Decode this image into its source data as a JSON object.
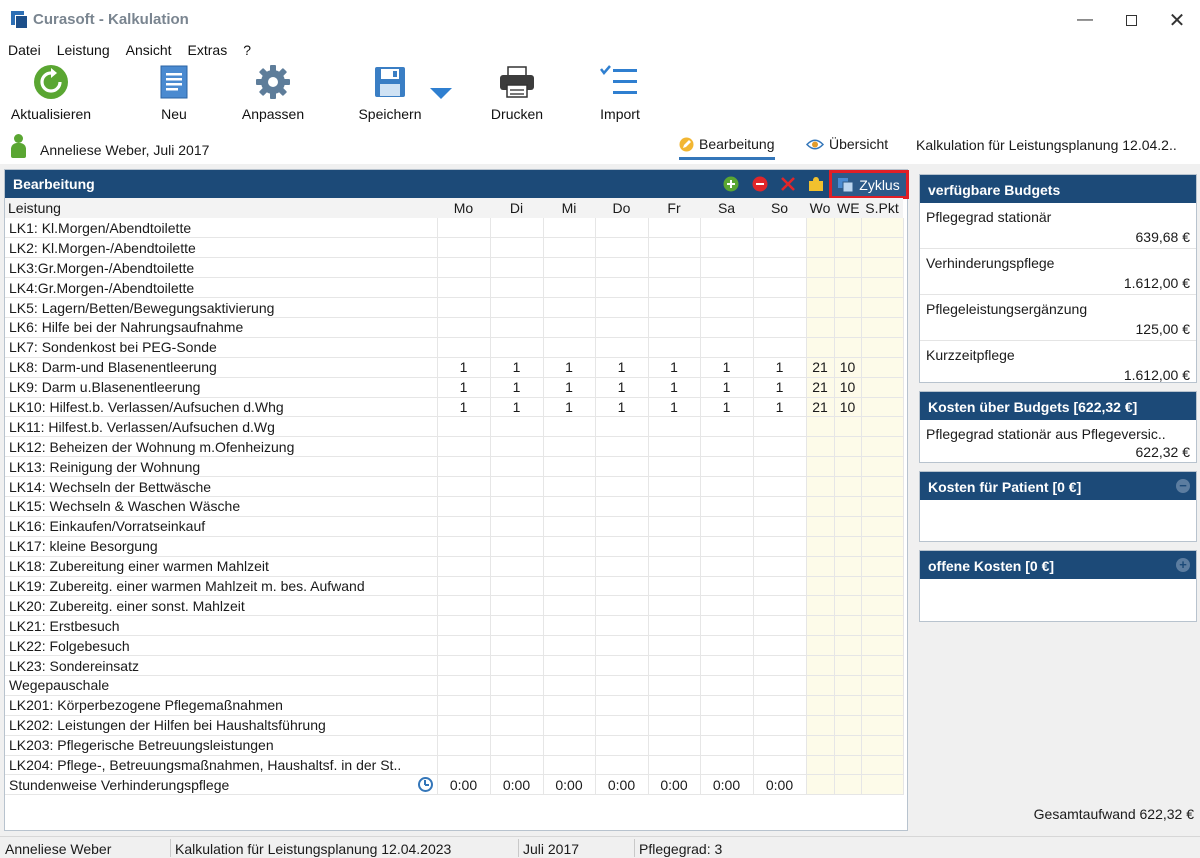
{
  "window": {
    "title": "Curasoft - Kalkulation"
  },
  "menu": [
    "Datei",
    "Leistung",
    "Ansicht",
    "Extras",
    "?"
  ],
  "toolbar": {
    "refresh": "Aktualisieren",
    "new": "Neu",
    "adjust": "Anpassen",
    "save": "Speichern",
    "print": "Drucken",
    "import": "Import"
  },
  "info": {
    "patient": "Anneliese Weber, Juli 2017",
    "tab_edit": "Bearbeitung",
    "tab_overview": "Übersicht",
    "calc_title": "Kalkulation für Leistungsplanung 12.04.2.."
  },
  "edit_panel": {
    "title": "Bearbeitung",
    "cycle_label": "Zyklus",
    "columns": [
      "Leistung",
      "Mo",
      "Di",
      "Mi",
      "Do",
      "Fr",
      "Sa",
      "So",
      "Wo",
      "WE",
      "S.Pkt"
    ],
    "rows": [
      [
        "LK1: Kl.Morgen/Abendtoilette",
        "",
        "",
        "",
        "",
        "",
        "",
        "",
        "",
        "",
        ""
      ],
      [
        "LK2: Kl.Morgen-/Abendtoilette",
        "",
        "",
        "",
        "",
        "",
        "",
        "",
        "",
        "",
        ""
      ],
      [
        "LK3:Gr.Morgen-/Abendtoilette",
        "",
        "",
        "",
        "",
        "",
        "",
        "",
        "",
        "",
        ""
      ],
      [
        "LK4:Gr.Morgen-/Abendtoilette",
        "",
        "",
        "",
        "",
        "",
        "",
        "",
        "",
        "",
        ""
      ],
      [
        "LK5: Lagern/Betten/Bewegungsaktivierung",
        "",
        "",
        "",
        "",
        "",
        "",
        "",
        "",
        "",
        ""
      ],
      [
        "LK6: Hilfe bei der Nahrungsaufnahme",
        "",
        "",
        "",
        "",
        "",
        "",
        "",
        "",
        "",
        ""
      ],
      [
        "LK7: Sondenkost bei PEG-Sonde",
        "",
        "",
        "",
        "",
        "",
        "",
        "",
        "",
        "",
        ""
      ],
      [
        "LK8: Darm-und Blasenentleerung",
        "1",
        "1",
        "1",
        "1",
        "1",
        "1",
        "1",
        "21",
        "10",
        ""
      ],
      [
        "LK9: Darm u.Blasenentleerung",
        "1",
        "1",
        "1",
        "1",
        "1",
        "1",
        "1",
        "21",
        "10",
        ""
      ],
      [
        "LK10: Hilfest.b. Verlassen/Aufsuchen d.Whg",
        "1",
        "1",
        "1",
        "1",
        "1",
        "1",
        "1",
        "21",
        "10",
        ""
      ],
      [
        "LK11: Hilfest.b. Verlassen/Aufsuchen d.Wg",
        "",
        "",
        "",
        "",
        "",
        "",
        "",
        "",
        "",
        ""
      ],
      [
        "LK12: Beheizen der Wohnung m.Ofenheizung",
        "",
        "",
        "",
        "",
        "",
        "",
        "",
        "",
        "",
        ""
      ],
      [
        "LK13: Reinigung der Wohnung",
        "",
        "",
        "",
        "",
        "",
        "",
        "",
        "",
        "",
        ""
      ],
      [
        "LK14: Wechseln der Bettwäsche",
        "",
        "",
        "",
        "",
        "",
        "",
        "",
        "",
        "",
        ""
      ],
      [
        "LK15: Wechseln & Waschen Wäsche",
        "",
        "",
        "",
        "",
        "",
        "",
        "",
        "",
        "",
        ""
      ],
      [
        "LK16: Einkaufen/Vorratseinkauf",
        "",
        "",
        "",
        "",
        "",
        "",
        "",
        "",
        "",
        ""
      ],
      [
        "LK17: kleine Besorgung",
        "",
        "",
        "",
        "",
        "",
        "",
        "",
        "",
        "",
        ""
      ],
      [
        "LK18: Zubereitung einer warmen Mahlzeit",
        "",
        "",
        "",
        "",
        "",
        "",
        "",
        "",
        "",
        ""
      ],
      [
        "LK19: Zubereitg. einer warmen Mahlzeit m. bes. Aufwand",
        "",
        "",
        "",
        "",
        "",
        "",
        "",
        "",
        "",
        ""
      ],
      [
        "LK20: Zubereitg. einer sonst. Mahlzeit",
        "",
        "",
        "",
        "",
        "",
        "",
        "",
        "",
        "",
        ""
      ],
      [
        "LK21: Erstbesuch",
        "",
        "",
        "",
        "",
        "",
        "",
        "",
        "",
        "",
        ""
      ],
      [
        "LK22: Folgebesuch",
        "",
        "",
        "",
        "",
        "",
        "",
        "",
        "",
        "",
        ""
      ],
      [
        "LK23: Sondereinsatz",
        "",
        "",
        "",
        "",
        "",
        "",
        "",
        "",
        "",
        ""
      ],
      [
        "Wegepauschale",
        "",
        "",
        "",
        "",
        "",
        "",
        "",
        "",
        "",
        ""
      ],
      [
        "LK201: Körperbezogene Pflegemaßnahmen",
        "",
        "",
        "",
        "",
        "",
        "",
        "",
        "",
        "",
        ""
      ],
      [
        "LK202: Leistungen der Hilfen bei Haushaltsführung",
        "",
        "",
        "",
        "",
        "",
        "",
        "",
        "",
        "",
        ""
      ],
      [
        "LK203: Pflegerische Betreuungsleistungen",
        "",
        "",
        "",
        "",
        "",
        "",
        "",
        "",
        "",
        ""
      ],
      [
        "LK204: Pflege-, Betreuungsmaßnahmen, Haushaltsf. in der St..",
        "",
        "",
        "",
        "",
        "",
        "",
        "",
        "",
        "",
        ""
      ],
      [
        "Stundenweise Verhinderungspflege",
        "0:00",
        "0:00",
        "0:00",
        "0:00",
        "0:00",
        "0:00",
        "0:00",
        "",
        "",
        ""
      ]
    ]
  },
  "budgets": {
    "title": "verfügbare Budgets",
    "items": [
      {
        "name": "Pflegegrad stationär",
        "value": "639,68 €"
      },
      {
        "name": "Verhinderungspflege",
        "value": "1.612,00 €"
      },
      {
        "name": "Pflegeleistungsergänzung",
        "value": "125,00 €"
      },
      {
        "name": "Kurzzeitpflege",
        "value": "1.612,00 €"
      }
    ]
  },
  "costs_budget": {
    "title": "Kosten über Budgets [622,32 €]",
    "item": {
      "name": "Pflegegrad stationär aus Pflegeversic..",
      "value": "622,32 €"
    }
  },
  "costs_patient": {
    "title": "Kosten für Patient [0 €]",
    "ctrl": "−"
  },
  "open_costs": {
    "title": "offene Kosten [0 €]",
    "ctrl": "+"
  },
  "total": "Gesamtaufwand 622,32 €",
  "statusbar": {
    "patient": "Anneliese Weber",
    "calc": "Kalkulation für Leistungsplanung 12.04.2023",
    "month": "Juli 2017",
    "care_level": "Pflegegrad: 3"
  },
  "colors": {
    "header": "#1c4a78",
    "highlight": "#e11f26",
    "accent": "#3476b9"
  }
}
